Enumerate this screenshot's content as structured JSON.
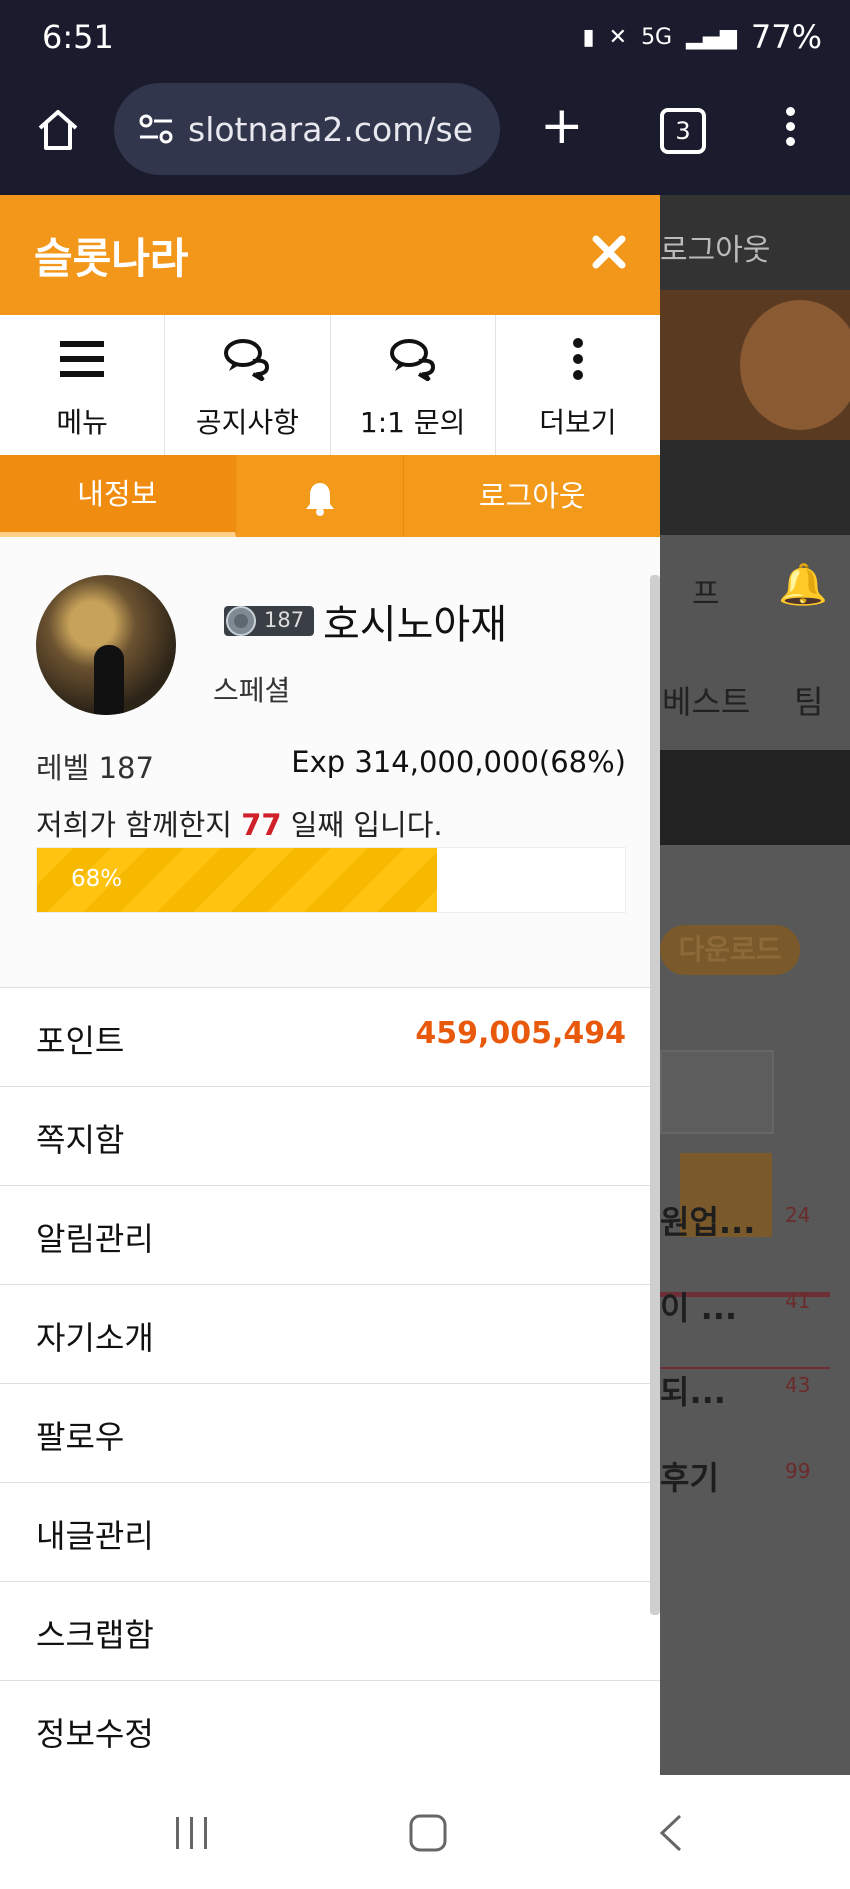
{
  "status_bar": {
    "time": "6:51",
    "network": "5G",
    "battery": "77%"
  },
  "browser": {
    "url": "slotnara2.com/se",
    "tab_count": "3"
  },
  "drawer": {
    "title": "슬롯나라",
    "quick_menu": [
      {
        "label": "메뉴",
        "icon": "hamburger-icon"
      },
      {
        "label": "공지사항",
        "icon": "chat-icon"
      },
      {
        "label": "1:1 문의",
        "icon": "chat-icon"
      },
      {
        "label": "더보기",
        "icon": "vertical-dots-icon"
      }
    ],
    "tabs": {
      "my_info": "내정보",
      "logout": "로그아웃"
    },
    "profile": {
      "level_badge": "187",
      "nickname": "호시노아재",
      "rank": "스페셜",
      "level": "레벨 187",
      "exp": "Exp 314,000,000(68%)",
      "days_prefix": "저희가 함께한지 ",
      "days": "77",
      "days_suffix": " 일째 입니다.",
      "progress_percent": 68,
      "progress_label": "68%"
    },
    "menu": {
      "points_label": "포인트",
      "points_value": "459,005,494",
      "items": [
        "쪽지함",
        "알림관리",
        "자기소개",
        "팔로우",
        "내글관리",
        "스크랩함",
        "정보수정"
      ]
    }
  },
  "background": {
    "logout": "로그아웃",
    "tab_fragment": "프",
    "nav_best": "베스트",
    "nav_partial": "팀",
    "download": "다운로드",
    "items": [
      {
        "text": "원업...",
        "count": "24"
      },
      {
        "text": "이 ...",
        "count": "41"
      },
      {
        "text": " 되...",
        "count": "43"
      },
      {
        "text": "후기",
        "count": "99"
      }
    ]
  },
  "colors": {
    "accent": "#f29719",
    "points": "#e8590c",
    "days": "#d0202a"
  }
}
